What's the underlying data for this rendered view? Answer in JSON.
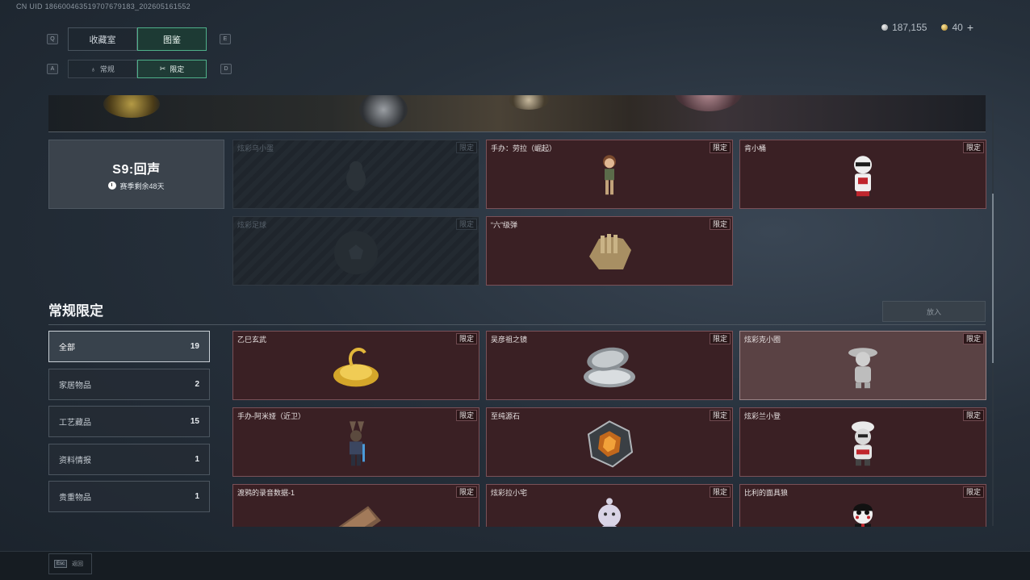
{
  "uid": "CN UID 18660046351970767918­3_202605161552",
  "currency": {
    "silver": "187,155",
    "gold": "40",
    "plus": "+"
  },
  "keys": {
    "q": "Q",
    "e": "E",
    "a": "A",
    "d": "D"
  },
  "tabs": [
    {
      "label": "收藏室"
    },
    {
      "label": "图鉴"
    }
  ],
  "subtabs": [
    {
      "label": "常规"
    },
    {
      "label": "限定"
    }
  ],
  "season": {
    "title": "S9:回声",
    "remaining": "赛季剩余48天"
  },
  "top_cards": [
    {
      "name": "炫彩乌小蛋",
      "tag": "限定"
    },
    {
      "name": "手办：劳拉（崛起）",
      "tag": "限定"
    },
    {
      "name": "肯小桶",
      "tag": "限定"
    },
    {
      "name": "炫彩足球",
      "tag": "限定"
    },
    {
      "name": "“六”级弹",
      "tag": "限定"
    }
  ],
  "section": {
    "title": "常规限定",
    "put_in": "放入"
  },
  "categories": [
    {
      "label": "全部",
      "count": "19"
    },
    {
      "label": "家居物品",
      "count": "2"
    },
    {
      "label": "工艺藏品",
      "count": "15"
    },
    {
      "label": "资料情报",
      "count": "1"
    },
    {
      "label": "贵重物品",
      "count": "1"
    }
  ],
  "grid_cards": [
    {
      "name": "乙巳玄武",
      "tag": "限定"
    },
    {
      "name": "吴彦祖之镜",
      "tag": "限定"
    },
    {
      "name": "炫彩克小圈",
      "tag": "限定"
    },
    {
      "name": "手办-阿米娅（近卫）",
      "tag": "限定"
    },
    {
      "name": "至纯源石",
      "tag": "限定"
    },
    {
      "name": "炫彩兰小登",
      "tag": "限定"
    },
    {
      "name": "渡鸦的录音数据-1",
      "tag": "限定"
    },
    {
      "name": "炫彩拉小宅",
      "tag": "限定"
    },
    {
      "name": "比利的面具狼",
      "tag": "限定"
    }
  ],
  "footer": {
    "esc_key": "Esc",
    "back": "返回"
  }
}
